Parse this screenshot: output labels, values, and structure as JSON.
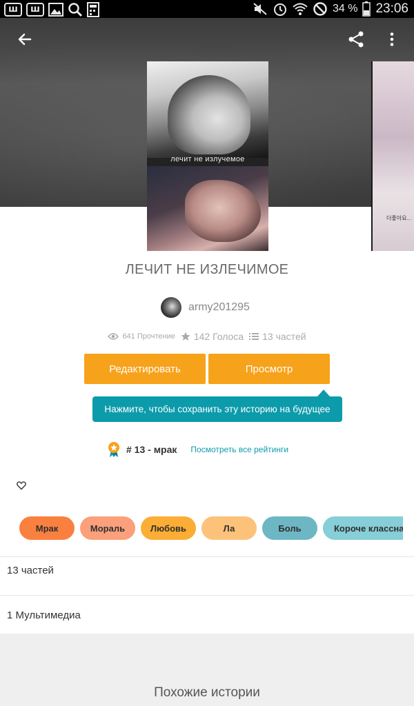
{
  "status_bar": {
    "badges": [
      "ш",
      "ш"
    ],
    "battery_percent": "34 %",
    "time": "23:06"
  },
  "header": {
    "icons": [
      "back-arrow-icon",
      "share-icon",
      "more-vert-icon"
    ]
  },
  "cover": {
    "caption": "лечит не излучемое",
    "side_label": "더좋아요..."
  },
  "story": {
    "title": "ЛЕЧИТ НЕ ИЗЛЕЧИМОЕ",
    "author": "army201295",
    "reads": "641 Прочтение",
    "votes": "142 Голоса",
    "parts": "13 частей"
  },
  "actions": {
    "edit_label": "Редактировать",
    "view_label": "Просмотр"
  },
  "tooltip": {
    "text": "Нажмите, чтобы сохранить эту историю на будущее"
  },
  "ranking": {
    "rank": "# 13 - мрак",
    "link": "Посмотреть все рейтинги"
  },
  "tags": [
    {
      "label": "Мрак",
      "color": "#fa8040"
    },
    {
      "label": "Мораль",
      "color": "#fba07b"
    },
    {
      "label": "Любовь",
      "color": "#fbad35"
    },
    {
      "label": "Ла",
      "color": "#fdc27a"
    },
    {
      "label": "Боль",
      "color": "#6db7c4"
    },
    {
      "label": "Короче классная",
      "color": "#86ced8"
    }
  ],
  "rows": {
    "parts_label": "13 частей",
    "media_label": "1 Мультимедиа"
  },
  "similar": {
    "title": "Похожие истории"
  },
  "colors": {
    "accent": "#f7a21b",
    "teal": "#0c9bab"
  }
}
